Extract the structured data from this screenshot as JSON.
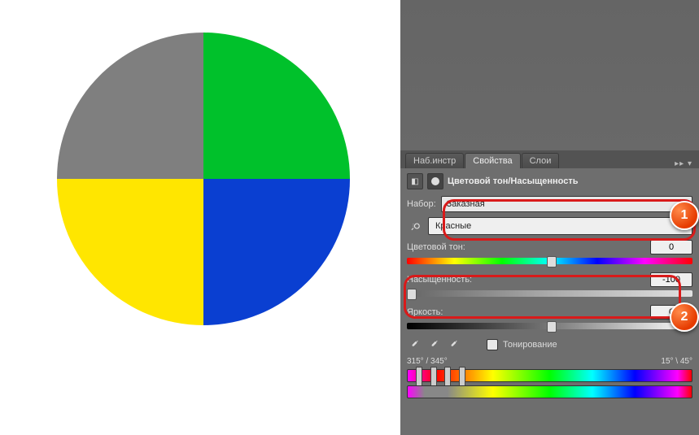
{
  "chart_data": {
    "type": "pie",
    "categories": [
      "Grey (desaturated Red)",
      "Green",
      "Yellow",
      "Blue"
    ],
    "values": [
      25,
      25,
      25,
      25
    ],
    "colors": [
      "#7f7f7f",
      "#00c12b",
      "#ffe600",
      "#0a3fd1"
    ],
    "title": ""
  },
  "tabs": {
    "tools": "Наб.инстр",
    "properties": "Свойства",
    "layers": "Слои",
    "flyout": "▸▸ ▾"
  },
  "header": {
    "title": "Цветовой тон/Насыщенность"
  },
  "preset": {
    "label": "Набор:",
    "value": "Заказная"
  },
  "channel": {
    "value": "Красные"
  },
  "hue": {
    "label": "Цветовой тон:",
    "value": "0",
    "pointer_pct": 49
  },
  "sat": {
    "label": "Насыщенность:",
    "value": "-100",
    "pointer_pct": 0
  },
  "light": {
    "label": "Яркость:",
    "value": "0",
    "pointer_pct": 49
  },
  "colorize": {
    "label": "Тонирование"
  },
  "range": {
    "left": "315° / 345°",
    "right": "15° \\ 45°"
  },
  "badges": {
    "one": "1",
    "two": "2"
  }
}
